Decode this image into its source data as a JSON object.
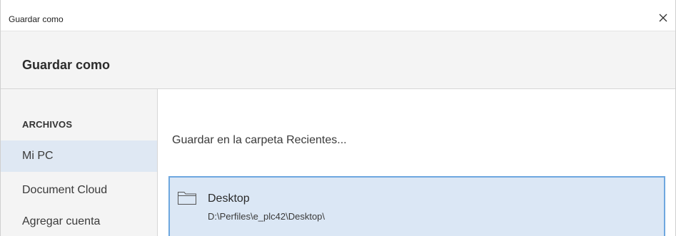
{
  "window": {
    "title": "Guardar como",
    "close_label": "×"
  },
  "header": {
    "title": "Guardar como"
  },
  "sidebar": {
    "heading": "ARCHIVOS",
    "items": [
      {
        "label": "Mi PC",
        "selected": true
      },
      {
        "label": "Document Cloud",
        "selected": false
      },
      {
        "label": "Agregar cuenta",
        "selected": false
      }
    ]
  },
  "main": {
    "recent_label": "Guardar en la carpeta Recientes...",
    "folders": [
      {
        "name": "Desktop",
        "path": "D:\\Perfiles\\e_plc42\\Desktop\\",
        "icon": "folder-icon",
        "selected": true
      }
    ]
  },
  "colors": {
    "selected_bg": "#dfe8f3",
    "folder_highlight_bg": "#dbe7f5",
    "folder_highlight_border": "#6ea7df",
    "panel_bg": "#f4f4f4"
  }
}
